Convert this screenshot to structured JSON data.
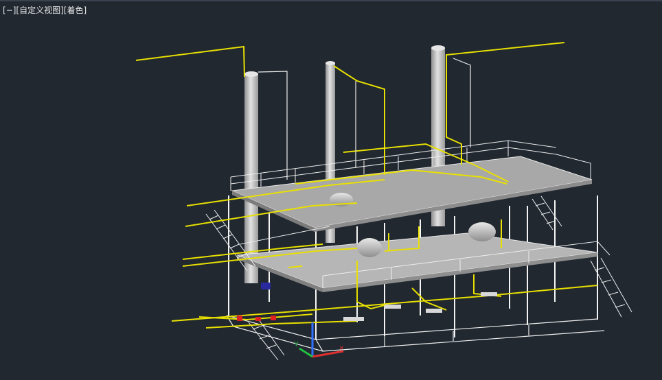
{
  "viewport": {
    "controls": {
      "viewport_menu": "[−]",
      "view_menu": "[自定义视图]",
      "visual_style_menu": "[着色]"
    }
  },
  "colors": {
    "background": "#212830",
    "structure": "#f2f2f2",
    "piping": "#e8e000",
    "vessel": "#c8c8c8",
    "deck": "#a9a9a9",
    "ucs_x": "#e03030",
    "ucs_y": "#20c040",
    "ucs_z": "#3070ff"
  }
}
